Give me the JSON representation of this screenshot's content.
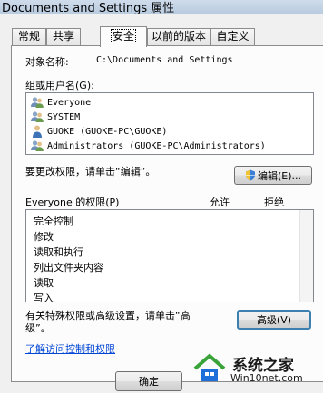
{
  "window": {
    "title": "Documents and Settings 属性"
  },
  "tabs": [
    {
      "label": "常规"
    },
    {
      "label": "共享"
    },
    {
      "label": "安全"
    },
    {
      "label": "以前的版本"
    },
    {
      "label": "自定义"
    }
  ],
  "security": {
    "object_name_label": "对象名称:",
    "object_name_value": "C:\\Documents and Settings",
    "groups_label": "组或用户名(G):",
    "users": [
      {
        "name": "Everyone",
        "icon": "users-group-icon"
      },
      {
        "name": "SYSTEM",
        "icon": "users-group-icon"
      },
      {
        "name": "GUOKE (GUOKE-PC\\GUOKE)",
        "icon": "user-icon"
      },
      {
        "name": "Administrators (GUOKE-PC\\Administrators)",
        "icon": "users-group-icon"
      }
    ],
    "change_hint": "要更改权限，请单击“编辑”。",
    "edit_button": "编辑(E)...",
    "permissions_label": "Everyone 的权限(P)",
    "allow_header": "允许",
    "deny_header": "拒绝",
    "permissions": [
      "完全控制",
      "修改",
      "读取和执行",
      "列出文件夹内容",
      "读取",
      "写入"
    ],
    "advanced_hint_line1": "有关特殊权限或高级设置，请单击“高",
    "advanced_hint_line2": "级”。",
    "advanced_button": "高级(V)",
    "learn_link": "了解访问控制和权限"
  },
  "footer": {
    "ok_button": "确定"
  },
  "watermark": {
    "brand": "系统之家",
    "site": "Win10net.com"
  },
  "colors": {
    "link": "#0046d5",
    "watermark_green": "#3aa33a",
    "watermark_blue": "#1e6fd9"
  }
}
